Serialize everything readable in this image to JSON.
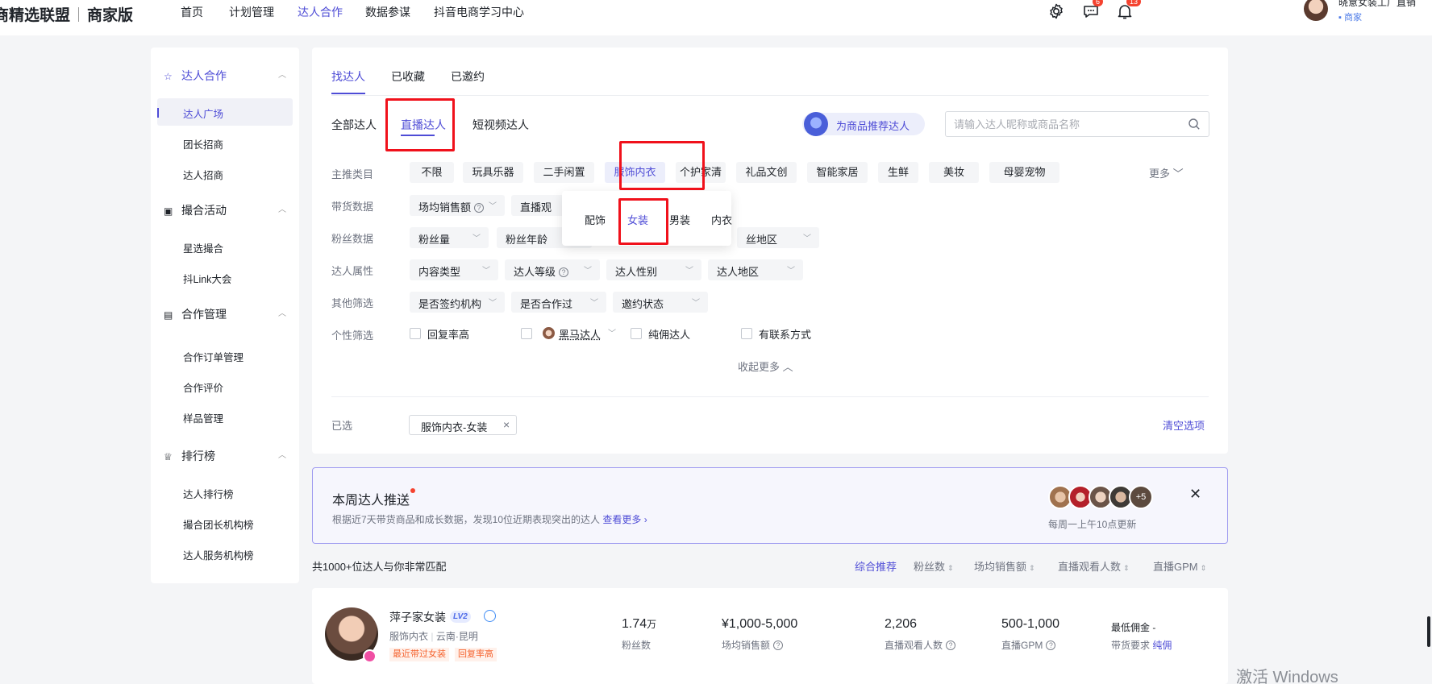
{
  "brand": {
    "title": "商精选联盟",
    "subtitle": "商家版"
  },
  "topnav": {
    "items": [
      "首页",
      "计划管理",
      "达人合作",
      "数据参谋",
      "抖音电商学习中心"
    ],
    "active": "达人合作",
    "message_badge": "6",
    "bell_badge": "13",
    "user_name": "晓意女装工厂直销",
    "user_role": "商家"
  },
  "sidebar": {
    "groups": [
      {
        "label": "达人合作",
        "icon": "star-icon",
        "items": [
          "达人广场",
          "团长招商",
          "达人招商"
        ]
      },
      {
        "label": "撮合活动",
        "icon": "calendar-icon",
        "items": [
          "星选撮合",
          "抖Link大会"
        ]
      },
      {
        "label": "合作管理",
        "icon": "clipboard-icon",
        "items": [
          "合作订单管理",
          "合作评价",
          "样品管理"
        ]
      },
      {
        "label": "排行榜",
        "icon": "trophy-icon",
        "items": [
          "达人排行榜",
          "撮合团长机构榜",
          "达人服务机构榜"
        ]
      }
    ],
    "active_item": "达人广场"
  },
  "tabs": [
    "找达人",
    "已收藏",
    "已邀约"
  ],
  "subtabs": [
    "全部达人",
    "直播达人",
    "短视频达人"
  ],
  "recommend_button": "为商品推荐达人",
  "search": {
    "placeholder": "请输入达人昵称或商品名称",
    "value": ""
  },
  "filters": {
    "main_category": {
      "label": "主推类目",
      "options": [
        "不限",
        "玩具乐器",
        "二手闲置",
        "服饰内衣",
        "个护家清",
        "礼品文创",
        "智能家居",
        "生鲜",
        "美妆",
        "母婴宠物"
      ],
      "active": "服饰内衣",
      "more": "更多"
    },
    "sales_data": {
      "label": "带货数据",
      "dropdowns": [
        "场均销售额",
        "直播观"
      ]
    },
    "fans_data": {
      "label": "粉丝数据",
      "dropdowns": [
        "粉丝量",
        "粉丝年龄",
        "丝地区"
      ]
    },
    "talent_attr": {
      "label": "达人属性",
      "dropdowns": [
        "内容类型",
        "达人等级",
        "达人性别",
        "达人地区"
      ]
    },
    "other": {
      "label": "其他筛选",
      "dropdowns": [
        "是否签约机构",
        "是否合作过",
        "邀约状态"
      ]
    },
    "personal": {
      "label": "个性筛选",
      "checkboxes": [
        "回复率高",
        "黑马达人",
        "纯佣达人",
        "有联系方式"
      ]
    },
    "collapse": "收起更多"
  },
  "subcategory_popup": {
    "items": [
      "配饰",
      "女装",
      "男装",
      "内衣"
    ],
    "active": "女装"
  },
  "selected": {
    "label": "已选",
    "tag": "服饰内衣-女装",
    "clear": "清空选项"
  },
  "weekly": {
    "title": "本周达人推送",
    "desc": "根据近7天带货商品和成长数据，发现10位近期表现突出的达人",
    "link": "查看更多",
    "extra_count": "+5",
    "update": "每周一上午10点更新"
  },
  "sort_bar": {
    "count": "共1000+位达人与你非常匹配",
    "options": [
      "综合推荐",
      "粉丝数",
      "场均销售额",
      "直播观看人数",
      "直播GPM"
    ],
    "active": "综合推荐"
  },
  "card": {
    "name": "萍子家女装",
    "level": "LV2",
    "category": "服饰内衣",
    "location": "云南·昆明",
    "tags": [
      "最近带过女装",
      "回复率高"
    ],
    "fans": {
      "value": "1.74",
      "unit": "万",
      "label": "粉丝数"
    },
    "sales": {
      "value": "¥1,000-5,000",
      "label": "场均销售额"
    },
    "viewers": {
      "value": "2,206",
      "label": "直播观看人数"
    },
    "gpm": {
      "value": "500-1,000",
      "label": "直播GPM"
    },
    "min_commission": "最低佣金 -",
    "requirement_label": "带货要求",
    "requirement_value": "纯佣"
  },
  "watermark": "激活 Windows",
  "colors": {
    "accent": "#4e4cd6",
    "highlight_box": "#f0111b",
    "badge": "#f5422f"
  }
}
